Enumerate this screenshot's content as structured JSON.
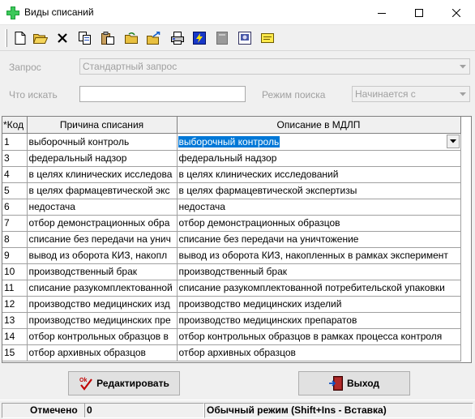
{
  "window": {
    "title": "Виды списаний"
  },
  "toolbar": {
    "icons": [
      "new-icon",
      "open-icon",
      "delete-icon",
      "copy-icon",
      "paste-icon",
      "refresh-icon",
      "export-icon",
      "print-icon",
      "lightning-icon",
      "document-icon",
      "preview-icon",
      "note-icon"
    ]
  },
  "filter": {
    "query_label": "Запрос",
    "query_value": "Стандартный запрос",
    "search_label": "Что искать",
    "search_value": "",
    "mode_label": "Режим поиска",
    "mode_value": "Начинается с"
  },
  "grid": {
    "columns": [
      "*Код",
      "Причина списания",
      "Описание в МДЛП"
    ],
    "rows": [
      {
        "code": "1",
        "reason": "выборочный контроль",
        "mdlp": "выборочный контроль"
      },
      {
        "code": "3",
        "reason": "федеральный надзор",
        "mdlp": "федеральный надзор"
      },
      {
        "code": "4",
        "reason": "в целях клинических исследова",
        "mdlp": "в целях клинических исследований"
      },
      {
        "code": "5",
        "reason": "в целях фармацевтической экс",
        "mdlp": "в целях фармацевтической экспертизы"
      },
      {
        "code": "6",
        "reason": "недостача",
        "mdlp": "недостача"
      },
      {
        "code": "7",
        "reason": "отбор демонстрационных обра",
        "mdlp": "отбор демонстрационных образцов"
      },
      {
        "code": "8",
        "reason": "списание без передачи на унич",
        "mdlp": "списание без передачи на уничтожение"
      },
      {
        "code": "9",
        "reason": "вывод из оборота КИЗ, накопл",
        "mdlp": "вывод из оборота КИЗ, накопленных в рамках эксперимент"
      },
      {
        "code": "10",
        "reason": "производственный брак",
        "mdlp": "производственный брак"
      },
      {
        "code": "11",
        "reason": "списание разукомплектованной",
        "mdlp": "списание разукомплектованной потребительской упаковки"
      },
      {
        "code": "12",
        "reason": "производство медицинских изд",
        "mdlp": "производство медицинских изделий"
      },
      {
        "code": "13",
        "reason": "производство медицинских пре",
        "mdlp": "производство медицинских препаратов"
      },
      {
        "code": "14",
        "reason": "отбор контрольных образцов в",
        "mdlp": "отбор контрольных образцов в рамках процесса контроля"
      },
      {
        "code": "15",
        "reason": "отбор архивных образцов",
        "mdlp": "отбор архивных образцов"
      }
    ]
  },
  "buttons": {
    "edit": "Редактировать",
    "exit": "Выход"
  },
  "status": {
    "marked_label": "Отмечено",
    "marked_value": "0",
    "mode": "Обычный режим (Shift+Ins - Вставка)"
  },
  "colors": {
    "selection": "#0078d7",
    "window_bg": "#f0f0f0"
  }
}
